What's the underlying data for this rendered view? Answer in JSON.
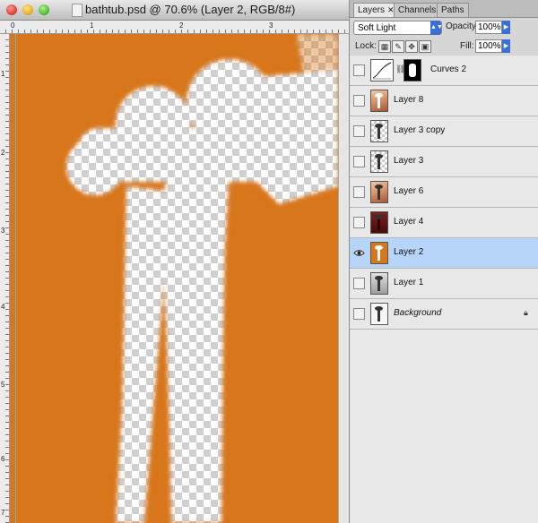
{
  "window": {
    "title": "bathtub.psd @ 70.6% (Layer 2, RGB/8#)"
  },
  "rulers": {
    "top": [
      "0",
      "1",
      "2",
      "3"
    ],
    "left": [
      "1",
      "2",
      "3",
      "4",
      "5",
      "6",
      "7"
    ]
  },
  "panel": {
    "tabs": [
      {
        "label": "Layers",
        "close": "✕"
      },
      {
        "label": "Channels"
      },
      {
        "label": "Paths"
      }
    ],
    "blend_mode": "Soft Light",
    "opacity_label": "Opacity:",
    "opacity_value": "100%",
    "lock_label": "Lock:",
    "fill_label": "Fill:",
    "fill_value": "100%",
    "layers": [
      {
        "name": "Curves 2",
        "visible": false,
        "kind": "adjustment"
      },
      {
        "name": "Layer 8",
        "visible": false,
        "thumb": "photo"
      },
      {
        "name": "Layer 3 copy",
        "visible": false,
        "thumb": "check"
      },
      {
        "name": "Layer 3",
        "visible": false,
        "thumb": "check"
      },
      {
        "name": "Layer 6",
        "visible": false,
        "thumb": "photo"
      },
      {
        "name": "Layer 4",
        "visible": false,
        "thumb": "dark"
      },
      {
        "name": "Layer 2",
        "visible": true,
        "selected": true,
        "thumb": "orange"
      },
      {
        "name": "Layer 1",
        "visible": false,
        "thumb": "gray"
      },
      {
        "name": "Background",
        "visible": false,
        "thumb": "white",
        "locked": true
      }
    ]
  },
  "colors": {
    "canvas_fill": "#d8761c",
    "selection": "#b6d5f9"
  }
}
